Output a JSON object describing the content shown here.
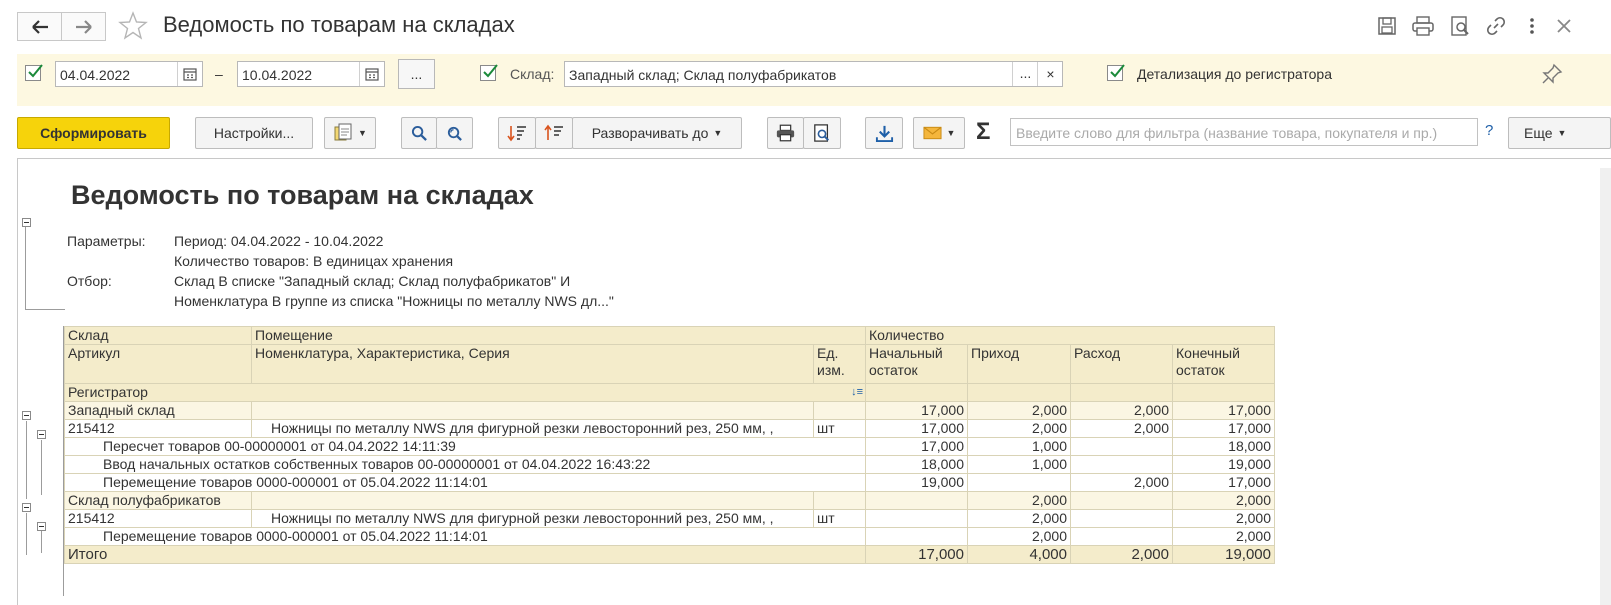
{
  "window": {
    "title": "Ведомость по товарам на складах"
  },
  "params": {
    "date_from": "04.04.2022",
    "dash": "–",
    "date_to": "10.04.2022",
    "period_button": "...",
    "sklad_label": "Склад:",
    "sklad_value": "Западный склад; Склад полуфабрикатов",
    "sklad_select": "...",
    "sklad_clear": "×",
    "detail_label": "Детализация до регистратора"
  },
  "toolbar": {
    "generate": "Сформировать",
    "settings": "Настройки...",
    "expand": "Разворачивать до",
    "filter_placeholder": "Введите слово для фильтра (название товара, покупателя и пр.)",
    "help": "?",
    "more": "Еще",
    "sigma": "Σ"
  },
  "report": {
    "title": "Ведомость по товарам на складах",
    "params_label": "Параметры:",
    "param1": "Период: 04.04.2022 - 10.04.2022",
    "param2": "Количество товаров: В единицах хранения",
    "filter_label": "Отбор:",
    "filter1": "Склад В списке \"Западный склад; Склад полуфабрикатов\" И",
    "filter2": "Номенклатура В группе из списка \"Ножницы по металлу NWS дл...\"",
    "headers": {
      "sklad": "Склад",
      "pomeshenie": "Помещение",
      "kolichestvo": "Количество",
      "artikul": "Артикул",
      "nomenklatura": "Номенклатура, Характеристика, Серия",
      "ed1": "Ед.",
      "ed2": "изм.",
      "nach1": "Начальный",
      "nach2": "остаток",
      "prihod": "Приход",
      "rashod": "Расход",
      "kon1": "Конечный",
      "kon2": "остаток",
      "registrator": "Регистратор",
      "sort_icon": "↓≡"
    },
    "rows": [
      {
        "c0": "Западный склад",
        "c1": "",
        "c2": "",
        "nach": "17,000",
        "prih": "2,000",
        "rash": "2,000",
        "kon": "17,000"
      },
      {
        "c0": "215412",
        "c1": "Ножницы по металлу NWS для фигурной резки левосторонний рез, 250 мм, ,",
        "c2": "шт",
        "nach": "17,000",
        "prih": "2,000",
        "rash": "2,000",
        "kon": "17,000"
      },
      {
        "c0": "Пересчет товаров 00-00000001 от 04.04.2022 14:11:39",
        "nach": "17,000",
        "prih": "1,000",
        "rash": "",
        "kon": "18,000"
      },
      {
        "c0": "Ввод начальных остатков собственных товаров 00-00000001 от 04.04.2022 16:43:22",
        "nach": "18,000",
        "prih": "1,000",
        "rash": "",
        "kon": "19,000"
      },
      {
        "c0": "Перемещение товаров 0000-000001 от 05.04.2022 11:14:01",
        "nach": "19,000",
        "prih": "",
        "rash": "2,000",
        "kon": "17,000"
      },
      {
        "c0": "Склад полуфабрикатов",
        "c1": "",
        "c2": "",
        "nach": "",
        "prih": "2,000",
        "rash": "",
        "kon": "2,000"
      },
      {
        "c0": "215412",
        "c1": "Ножницы по металлу NWS для фигурной резки левосторонний рез, 250 мм, ,",
        "c2": "шт",
        "nach": "",
        "prih": "2,000",
        "rash": "",
        "kon": "2,000"
      },
      {
        "c0": "Перемещение товаров 0000-000001 от 05.04.2022 11:14:01",
        "nach": "",
        "prih": "2,000",
        "rash": "",
        "kon": "2,000"
      }
    ],
    "total": {
      "label": "Итого",
      "nach": "17,000",
      "prih": "4,000",
      "rash": "2,000",
      "kon": "19,000"
    }
  }
}
